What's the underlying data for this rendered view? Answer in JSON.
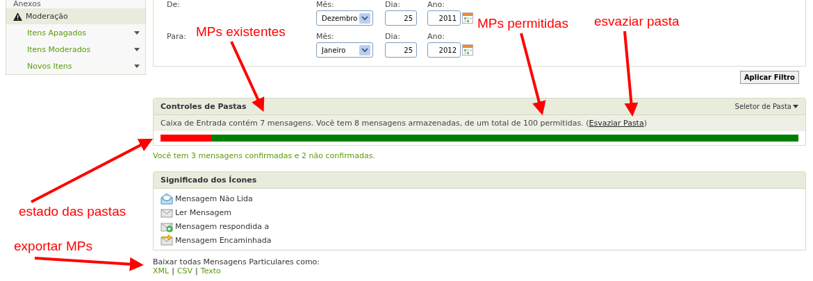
{
  "sidebar": {
    "items": [
      {
        "label": "Anexos",
        "kind": "plain"
      },
      {
        "label": "Moderação",
        "kind": "header"
      },
      {
        "label": "Itens Apagados",
        "kind": "link"
      },
      {
        "label": "Itens Moderados",
        "kind": "link"
      },
      {
        "label": "Novos Itens",
        "kind": "link"
      }
    ]
  },
  "filter": {
    "rows": [
      {
        "label": "De:",
        "month_label": "Mês:",
        "month": "Dezembro",
        "day_label": "Dia:",
        "day": "25",
        "year_label": "Ano:",
        "year": "2011"
      },
      {
        "label": "Para:",
        "month_label": "Mês:",
        "month": "Janeiro",
        "day_label": "Dia:",
        "day": "25",
        "year_label": "Ano:",
        "year": "2012"
      }
    ],
    "apply_button": "Aplicar Filtro"
  },
  "folder_controls": {
    "title": "Controles de Pastas",
    "selector": "Seletor de Pasta",
    "info_before": "Caixa de Entrada contém 7 mensagens. Você tem 8 mensagens armazenadas, de um total de 100 permitidas. (",
    "empty_link": "Esvaziar Pasta",
    "info_after": ")",
    "level": 0.08
  },
  "confirmed_note": "Você tem 3 mensagens confirmadas e 2 não confirmadas.",
  "icon_legend": {
    "title": "Significado dos Ícones",
    "items": [
      {
        "kind": "unread",
        "label": "Mensagem Não Lida"
      },
      {
        "kind": "read",
        "label": "Ler Mensagem"
      },
      {
        "kind": "replied",
        "label": "Mensagem respondida a"
      },
      {
        "kind": "forwarded",
        "label": "Mensagem Encaminhada"
      }
    ]
  },
  "download": {
    "label": "Baixar todas Mensagens Particulares como:",
    "links": [
      "XML",
      "CSV",
      "Texto"
    ],
    "separator": "|"
  },
  "annotations": [
    {
      "text": "MPs existentes"
    },
    {
      "text": "MPs permitidas"
    },
    {
      "text": "esvaziar pasta"
    },
    {
      "text": "estado das pastas"
    },
    {
      "text": "exportar MPs"
    }
  ]
}
